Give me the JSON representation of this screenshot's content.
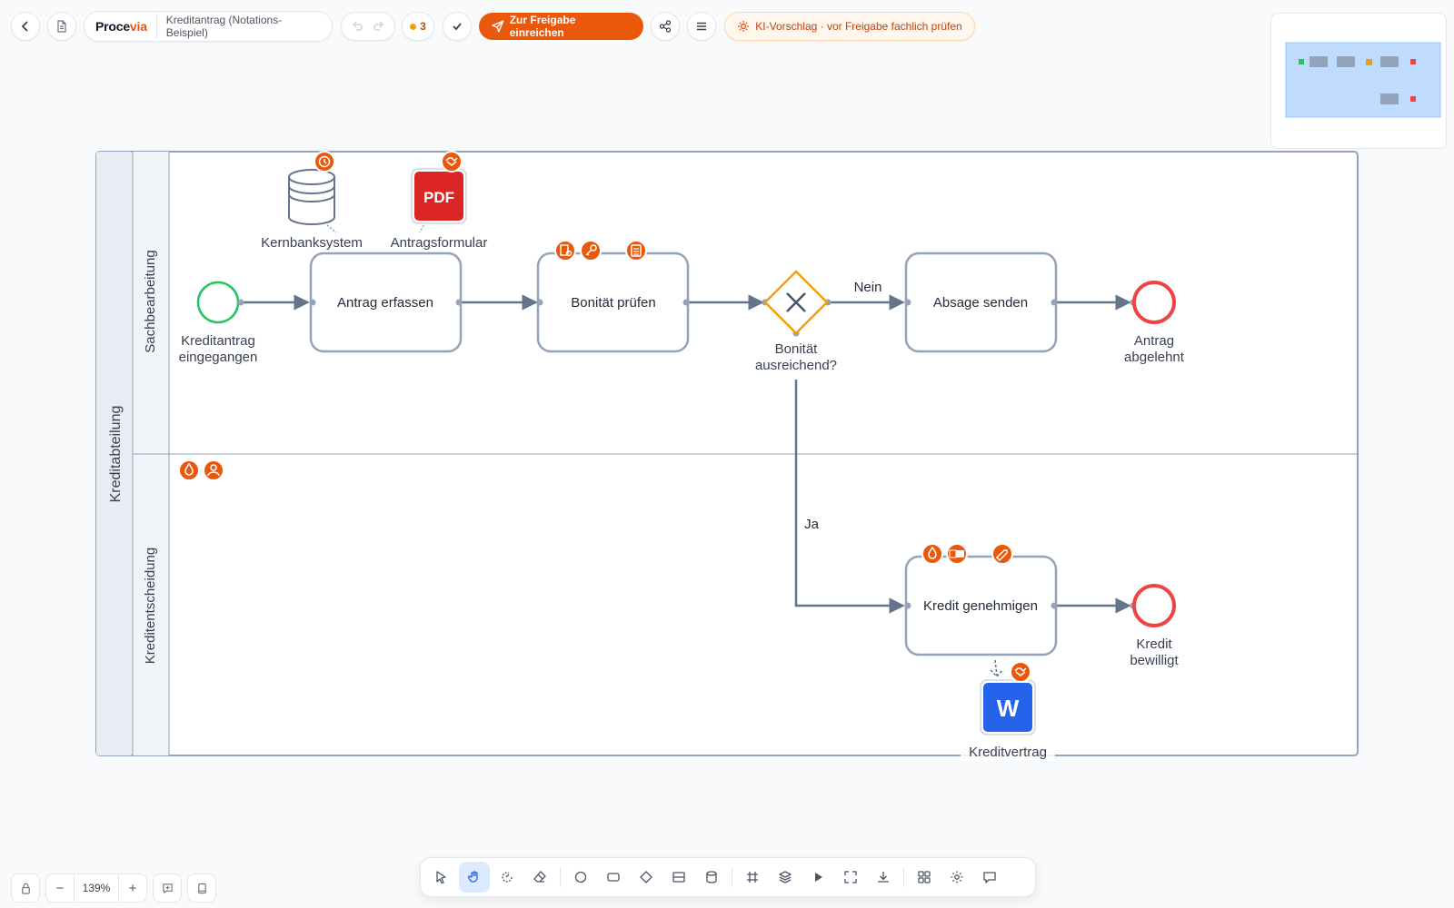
{
  "app": {
    "brand_a": "Proce",
    "brand_b": "via",
    "document_title": "Kreditantrag (Notations-Beispiel)"
  },
  "toolbar": {
    "issue_count": "3",
    "submit_label": "Zur Freigabe einreichen",
    "ai_label": "KI-Vorschlag · vor Freigabe fachlich prüfen"
  },
  "colors": {
    "accent": "#ea580c",
    "start_event": "#22c55e",
    "end_event": "#ef4444",
    "gateway": "#f59e0b",
    "issue_dot": "#f59e0b"
  },
  "diagram": {
    "pool": "Kreditabteilung",
    "lanes": [
      "Sachbearbeitung",
      "Kreditentscheidung"
    ],
    "start_event": {
      "label_1": "Kreditantrag",
      "label_2": "eingegangen"
    },
    "tasks": {
      "erfassen": "Antrag erfassen",
      "pruefen": "Bonität prüfen",
      "absage": "Absage senden",
      "genehmigen": "Kredit genehmigen"
    },
    "gateway": {
      "label_1": "Bonität",
      "label_2": "ausreichend?",
      "no": "Nein",
      "yes": "Ja"
    },
    "end_rejected": {
      "label_1": "Antrag",
      "label_2": "abgelehnt"
    },
    "end_approved": {
      "label_1": "Kredit",
      "label_2": "bewilligt"
    },
    "artifacts": {
      "db": "Kernbanksystem",
      "pdf_badge": "PDF",
      "pdf": "Antragsformular",
      "word_badge": "W",
      "word": "Kreditvertrag"
    }
  },
  "zoom": {
    "level": "139%",
    "minus": "−",
    "plus": "+"
  }
}
